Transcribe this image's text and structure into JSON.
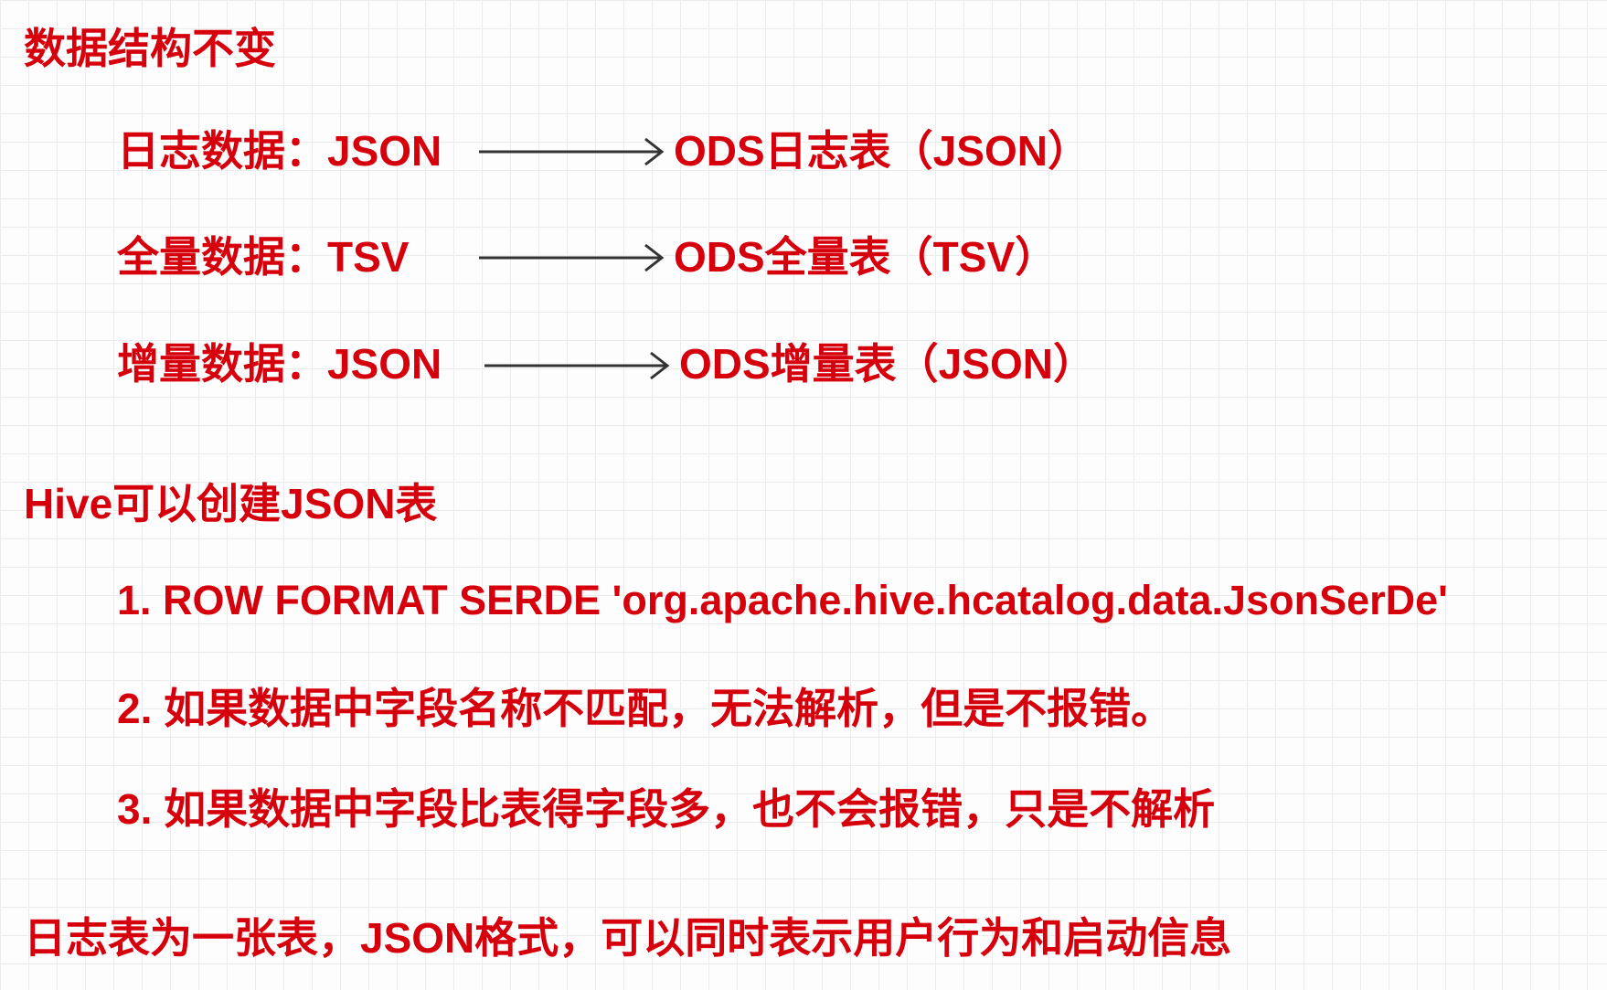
{
  "sections": {
    "structure_title": "数据结构不变",
    "hive_title": "Hive可以创建JSON表",
    "summary": "日志表为一张表，JSON格式，可以同时表示用户行为和启动信息"
  },
  "mappings": [
    {
      "source": "日志数据：JSON",
      "target": "ODS日志表（JSON）"
    },
    {
      "source": "全量数据：TSV",
      "target": "ODS全量表（TSV）"
    },
    {
      "source": "增量数据：JSON",
      "target": "ODS增量表（JSON）"
    }
  ],
  "notes": [
    "1. ROW FORMAT SERDE 'org.apache.hive.hcatalog.data.JsonSerDe'",
    "2. 如果数据中字段名称不匹配，无法解析，但是不报错。",
    "3. 如果数据中字段比表得字段多，也不会报错，只是不解析"
  ],
  "colors": {
    "text": "#d6000d",
    "arrow": "#333333",
    "grid": "#ececec",
    "background": "#fdfdfd"
  }
}
